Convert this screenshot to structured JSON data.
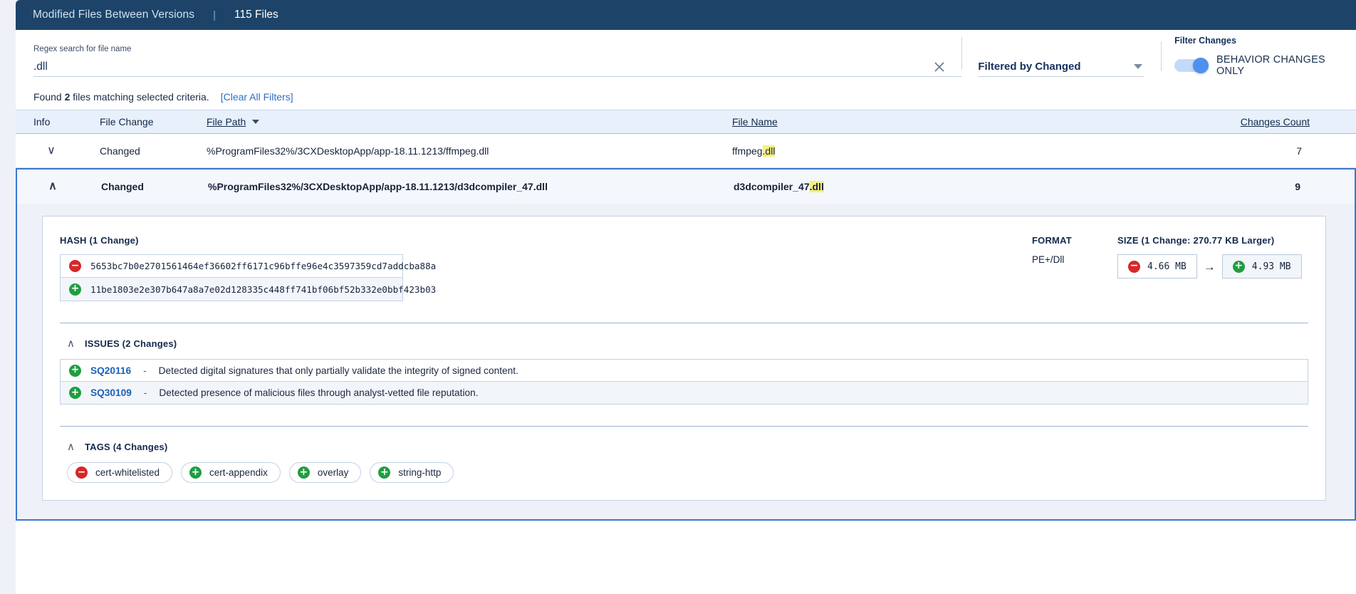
{
  "titlebar": {
    "title": "Modified Files Between Versions",
    "separator": "|",
    "file_count": "115 Files"
  },
  "filters": {
    "search_label": "Regex search for file name",
    "search_value": ".dll",
    "search_placeholder": "",
    "clear_icon": "close-x-icon",
    "dropdown_value": "Filtered by Changed",
    "toggle_caption": "Filter Changes",
    "toggle_label": "BEHAVIOR CHANGES ONLY",
    "toggle_on": true,
    "accent_blue": "#4f90f0"
  },
  "results": {
    "found_prefix": "Found",
    "found_count": "2",
    "found_suffix": "files matching selected criteria.",
    "clear_all": "[Clear All Filters]"
  },
  "table": {
    "headers": {
      "info": "Info",
      "file_change": "File Change",
      "file_path": "File Path",
      "file_name": "File Name",
      "changes_count": "Changes Count"
    },
    "rows": [
      {
        "expanded": false,
        "chevron": "chevron-down-icon",
        "chevron_glyph": "∨",
        "change": "Changed",
        "path": "%ProgramFiles32%/3CXDesktopApp/app-18.11.1213/ffmpeg.dll",
        "name_base": "ffmpeg",
        "name_hl": ".dll",
        "count": "7"
      },
      {
        "expanded": true,
        "chevron": "chevron-up-icon",
        "chevron_glyph": "∧",
        "change": "Changed",
        "path": "%ProgramFiles32%/3CXDesktopApp/app-18.11.1213/d3dcompiler_47.dll",
        "name_base": "d3dcompiler_47",
        "name_hl": ".dll",
        "count": "9"
      }
    ]
  },
  "detail": {
    "hash": {
      "title": "HASH (1 Change)",
      "removed": "5653bc7b0e2701561464ef36602ff6171c96bffe96e4c3597359cd7addcba88a",
      "added": "11be1803e2e307b647a8a7e02d128335c448ff741bf06bf52b332e0bbf423b03",
      "removed_badge": "−",
      "added_badge": "+"
    },
    "format": {
      "title": "FORMAT",
      "value": "PE+/Dll"
    },
    "size": {
      "title": "SIZE (1 Change: 270.77 KB Larger)",
      "old_value": "4.66 MB",
      "new_value": "4.93 MB",
      "arrow": "→"
    },
    "issues": {
      "title": "ISSUES (2 Changes)",
      "items": [
        {
          "badge": "+",
          "id": "SQ20116",
          "dash": "-",
          "text": "Detected digital signatures that only partially validate the integrity of signed content."
        },
        {
          "badge": "+",
          "id": "SQ30109",
          "dash": "-",
          "text": "Detected presence of malicious files through analyst-vetted file reputation."
        }
      ]
    },
    "tags": {
      "title": "TAGS (4 Changes)",
      "items": [
        {
          "badge": "−",
          "kind": "minus",
          "label": "cert-whitelisted"
        },
        {
          "badge": "+",
          "kind": "plus",
          "label": "cert-appendix"
        },
        {
          "badge": "+",
          "kind": "plus",
          "label": "overlay"
        },
        {
          "badge": "+",
          "kind": "plus",
          "label": "string-http"
        }
      ]
    }
  }
}
